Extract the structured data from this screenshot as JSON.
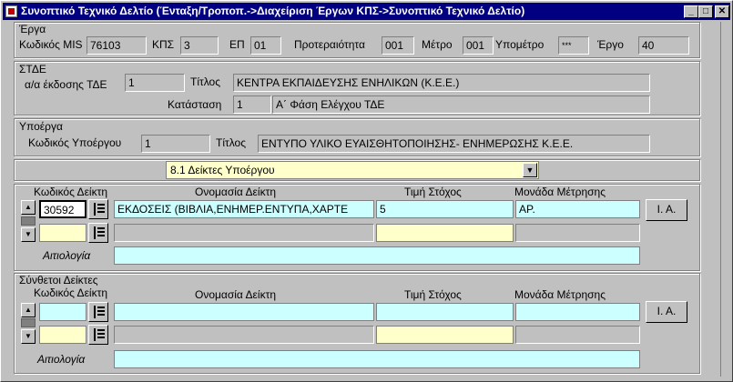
{
  "window": {
    "title": "Συνοπτικό Τεχνικό Δελτίο (Ένταξη/Τροποπ.->Διαχείριση Έργων ΚΠΣ->Συνοπτικό Τεχνικό Δελτίο)",
    "min_glyph": "_",
    "max_glyph": "□",
    "close_glyph": "✕"
  },
  "erga": {
    "section_label": "Έργα",
    "mis_label": "Κωδικός MIS",
    "mis_value": "76103",
    "kps_label": "ΚΠΣ",
    "kps_value": "3",
    "ep_label": "ΕΠ",
    "ep_value": "01",
    "priority_label": "Προτεραιότητα",
    "priority_value": "001",
    "metro_label": "Μέτρο",
    "metro_value": "001",
    "ypometro_label": "Υπομέτρο",
    "ypometro_value": "***",
    "ergo_label": "Έργο",
    "ergo_value": "40"
  },
  "stde": {
    "section_label": "ΣΤΔΕ",
    "aa_label": "α/α έκδοσης ΤΔΕ",
    "aa_value": "1",
    "title_label": "Τίτλος",
    "title_value": "ΚΕΝΤΡΑ ΕΚΠΑΙΔΕΥΣΗΣ ΕΝΗΛΙΚΩΝ (Κ.Ε.Ε.)",
    "status_label": "Κατάσταση",
    "status_code": "1",
    "status_value": "Α΄ Φάση Ελέγχου ΤΔΕ"
  },
  "ypoerga": {
    "section_label": "Υποέργα",
    "code_label": "Κωδικός Υποέργου",
    "code_value": "1",
    "title_label": "Τίτλος",
    "title_value": "ΕΝΤΥΠΟ ΥΛΙΚΟ ΕΥΑΙΣΘΗΤΟΠΟΙΗΣΗΣ- ΕΝΗΜΕΡΩΣΗΣ Κ.Ε.Ε."
  },
  "selector": {
    "selected": "8.1 Δείκτες Υποέργου"
  },
  "deiktes": {
    "col_code": "Κωδικός Δείκτη",
    "col_name": "Ονομασία Δείκτη",
    "col_target": "Τιμή Στόχος",
    "col_unit": "Μονάδα Μέτρησης",
    "rows": [
      {
        "code": "30592",
        "name": "ΕΚΔΟΣΕΙΣ (ΒΙΒΛΙΑ,ΕΝΗΜΕΡ.ΕΝΤΥΠΑ,ΧΑΡΤΕ",
        "target": "5",
        "unit": "ΑΡ."
      },
      {
        "code": "",
        "name": "",
        "target": "",
        "unit": ""
      }
    ],
    "ia_button": "Ι. Α.",
    "justification_label": "Αιτιολογία",
    "justification_value": ""
  },
  "synthetoi": {
    "section_label": "Σύνθετοι Δείκτες",
    "col_code": "Κωδικός Δείκτη",
    "col_name": "Ονομασία Δείκτη",
    "col_target": "Τιμή Στόχος",
    "col_unit": "Μονάδα Μέτρησης",
    "rows": [
      {
        "code": "",
        "name": "",
        "target": "",
        "unit": ""
      },
      {
        "code": "",
        "name": "",
        "target": "",
        "unit": ""
      }
    ],
    "ia_button": "Ι. Α.",
    "justification_label": "Αιτιολογία",
    "justification_value": ""
  },
  "icons": {
    "spin_up": "▲",
    "spin_down": "▼",
    "dropdown": "▼"
  }
}
